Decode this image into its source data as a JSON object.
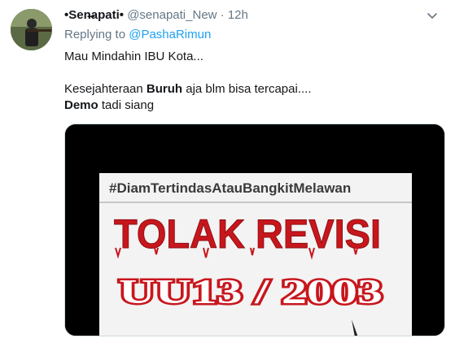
{
  "tweet": {
    "display_name": "•Sen̶apati•",
    "handle": "@senapati_New",
    "separator": "·",
    "time": "12h",
    "reply_prefix": "Replying to",
    "reply_to": "@PashaRimun",
    "line1": "Mau Mindahin IBU Kota...",
    "line2_a": "Kesejahteraan ",
    "line2_bold": "Buruh",
    "line2_b": " aja blm bisa tercapai....",
    "line3_bold": "Demo",
    "line3_b": " tadi siang"
  },
  "media": {
    "hashtag": "#DiamTertindasAtauBangkitMelawan",
    "headline": "TOLAK REVISI",
    "subline": "UU13 / 2003"
  },
  "icons": {
    "menu": "chevron-down-icon"
  },
  "colors": {
    "link": "#1da1f2",
    "secondary_text": "#657786",
    "headline_red": "#c8161d"
  }
}
